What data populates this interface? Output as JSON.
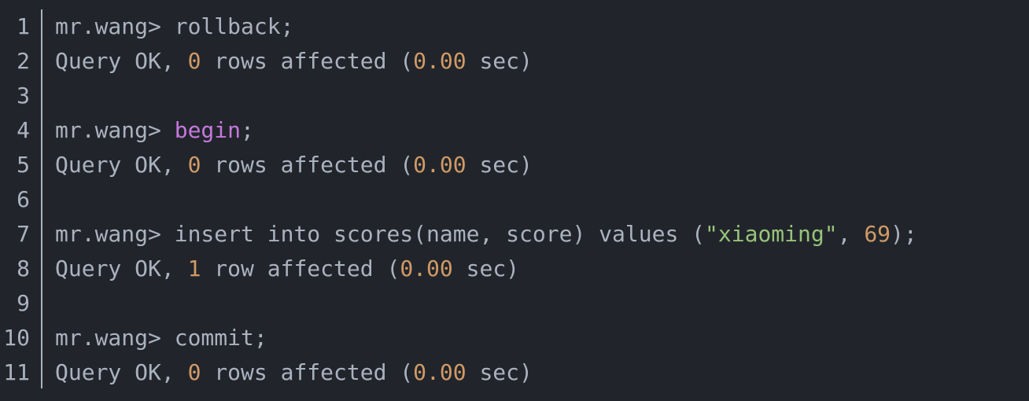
{
  "line_numbers": [
    "1",
    "2",
    "3",
    "4",
    "5",
    "6",
    "7",
    "8",
    "9",
    "10",
    "11"
  ],
  "lines": [
    {
      "prompt": "mr.wang> ",
      "cmd": "rollback",
      "end": ";"
    },
    {
      "pre": "Query OK, ",
      "count": "0",
      "mid": " rows affected (",
      "time": "0.00",
      "post": " sec)"
    },
    {},
    {
      "prompt": "mr.wang> ",
      "kw": "begin",
      "end": ";"
    },
    {
      "pre": "Query OK, ",
      "count": "0",
      "mid": " rows affected (",
      "time": "0.00",
      "post": " sec)"
    },
    {},
    {
      "prompt": "mr.wang> ",
      "cmd": "insert into scores(name, score) values (",
      "str": "\"xiaoming\"",
      "sep": ", ",
      "num": "69",
      "end": ");"
    },
    {
      "pre": "Query OK, ",
      "count": "1",
      "mid": " row affected (",
      "time": "0.00",
      "post": " sec)"
    },
    {},
    {
      "prompt": "mr.wang> ",
      "cmd": "commit",
      "end": ";"
    },
    {
      "pre": "Query OK, ",
      "count": "0",
      "mid": " rows affected (",
      "time": "0.00",
      "post": " sec)"
    }
  ],
  "colors": {
    "background": "#21252b",
    "text": "#abb2bf",
    "number": "#d19a66",
    "keyword": "#c678dd",
    "string": "#98c379"
  }
}
